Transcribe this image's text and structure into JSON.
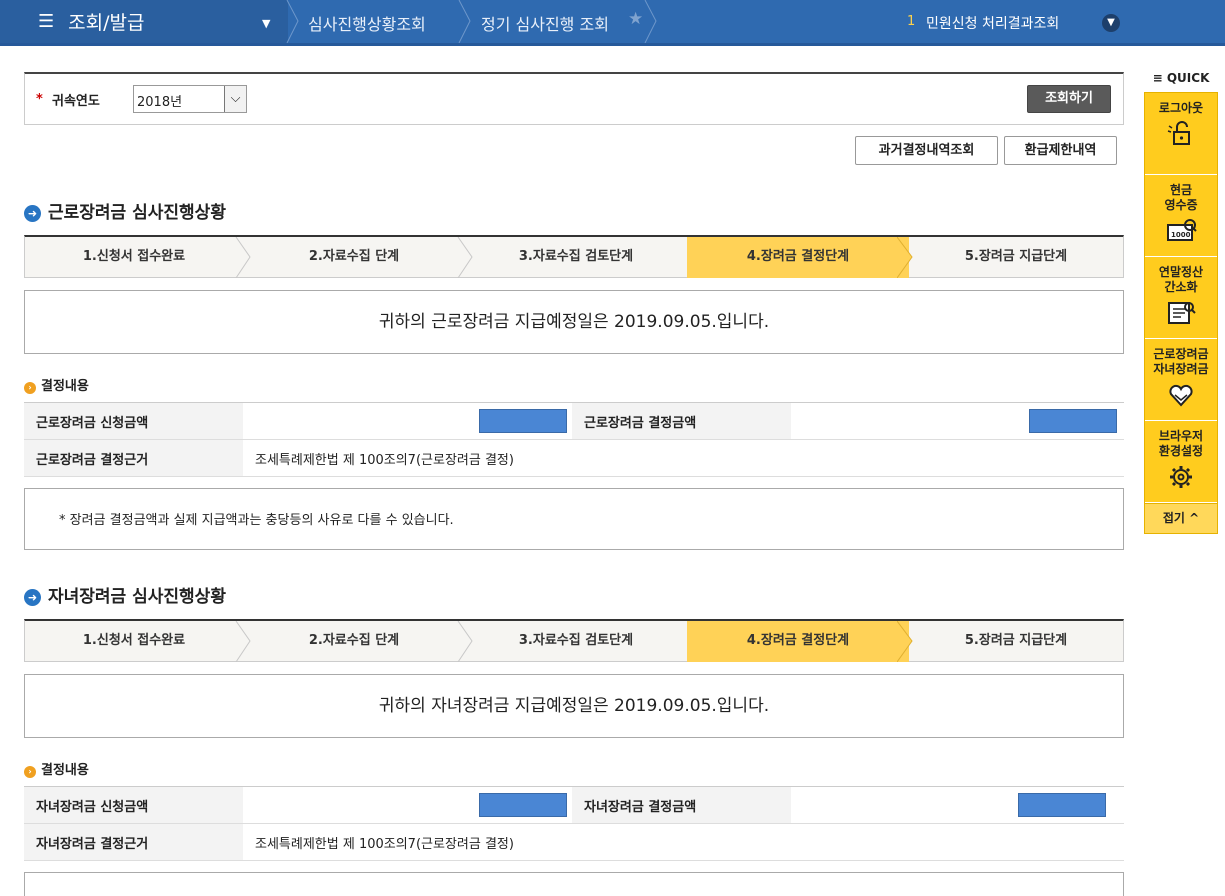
{
  "nav": {
    "menu_title": "조회/발급",
    "breadcrumb1": "심사진행상황조회",
    "breadcrumb2": "정기 심사진행 조회",
    "notice_number": "1",
    "notice_text": "민원신청 처리결과조회"
  },
  "search": {
    "required_mark": "*",
    "label": "귀속연도",
    "year_value": "2018년",
    "search_button": "조회하기"
  },
  "buttons": {
    "past_decisions": "과거결정내역조회",
    "refund_limit": "환급제한내역"
  },
  "steps": [
    "1.신청서 접수완료",
    "2.자료수집 단계",
    "3.자료수집 검토단계",
    "4.장려금 결정단계",
    "5.장려금 지급단계"
  ],
  "active_step_index": 3,
  "earned": {
    "title": "근로장려금 심사진행상황",
    "notice": "귀하의 근로장려금 지급예정일은 2019.09.05.입니다.",
    "decision_heading": "결정내용",
    "applied_label": "근로장려금 신청금액",
    "decided_label": "근로장려금 결정금액",
    "basis_label": "근로장려금 결정근거",
    "basis_value": "조세특례제한법 제 100조의7(근로장려금 결정)",
    "footnote": "* 장려금 결정금액과 실제 지급액과는 충당등의 사유로 다를 수 있습니다."
  },
  "child": {
    "title": "자녀장려금 심사진행상황",
    "notice": "귀하의 자녀장려금 지급예정일은 2019.09.05.입니다.",
    "decision_heading": "결정내용",
    "applied_label": "자녀장려금 신청금액",
    "decided_label": "자녀장려금 결정금액",
    "basis_label": "자녀장려금 결정근거",
    "basis_value": "조세특례제한법 제 100조의7(근로장려금 결정)"
  },
  "quick": {
    "title": "≡ QUICK",
    "items": [
      "로그아웃",
      "현금\n영수증",
      "연말정산\n간소화",
      "근로장려금\n자녀장려금",
      "브라우저\n환경설정"
    ],
    "fold": "접기 ^"
  },
  "colors": {
    "nav_blue": "#2f6ab0",
    "active_step": "#ffd257",
    "quick_yellow": "#ffcc1e",
    "masked_value": "#4a86d4"
  }
}
